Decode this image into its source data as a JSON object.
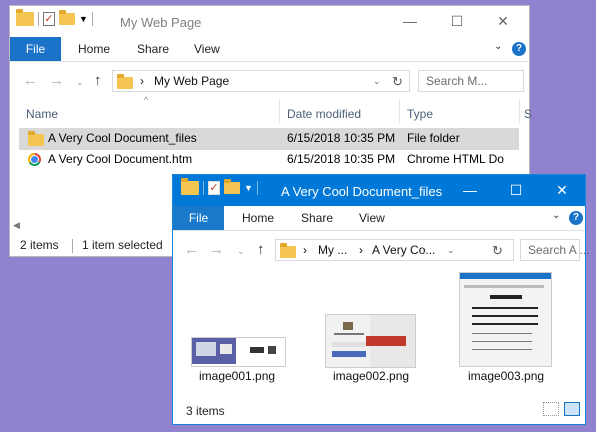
{
  "window_back": {
    "title": "My Web Page",
    "ribbon": {
      "file": "File",
      "tabs": [
        "Home",
        "Share",
        "View"
      ],
      "help": "?"
    },
    "nav": {
      "back": "←",
      "forward": "→",
      "dropdown": "⌄",
      "up": "↑"
    },
    "address": {
      "crumb_separator": "›",
      "path": "My Web Page"
    },
    "search_placeholder": "Search M...",
    "columns": [
      "Name",
      "Date modified",
      "Type",
      "S"
    ],
    "sort_arrow": "^",
    "rows": [
      {
        "name": "A Very Cool Document_files",
        "date": "6/15/2018 10:35 PM",
        "type": "File folder",
        "icon": "folder-icon",
        "selected": true
      },
      {
        "name": "A Very Cool Document.htm",
        "date": "6/15/2018 10:35 PM",
        "type": "Chrome HTML Do",
        "icon": "chrome-icon",
        "selected": false
      }
    ],
    "status": {
      "items": "2 items",
      "selected": "1 item selected"
    }
  },
  "window_front": {
    "title": "A Very Cool Document_files",
    "ribbon": {
      "file": "File",
      "tabs": [
        "Home",
        "Share",
        "View"
      ],
      "help": "?"
    },
    "nav": {
      "back": "←",
      "forward": "→",
      "dropdown": "⌄",
      "up": "↑"
    },
    "address": {
      "crumb_separator": "›",
      "crumbs": [
        "My ...",
        "A Very Co..."
      ]
    },
    "search_placeholder": "Search A ...",
    "files": [
      {
        "name": "image001.png"
      },
      {
        "name": "image002.png"
      },
      {
        "name": "image003.png"
      }
    ],
    "status": {
      "items": "3 items"
    }
  },
  "window_controls": {
    "minimize": "—",
    "maximize": "☐",
    "close": "✕"
  },
  "colors": {
    "accent": "#0078d7",
    "file_tab": "#1a73c9",
    "desktop": "#9082cf",
    "selection": "#d9d9d9",
    "folder": "#f4c551"
  }
}
